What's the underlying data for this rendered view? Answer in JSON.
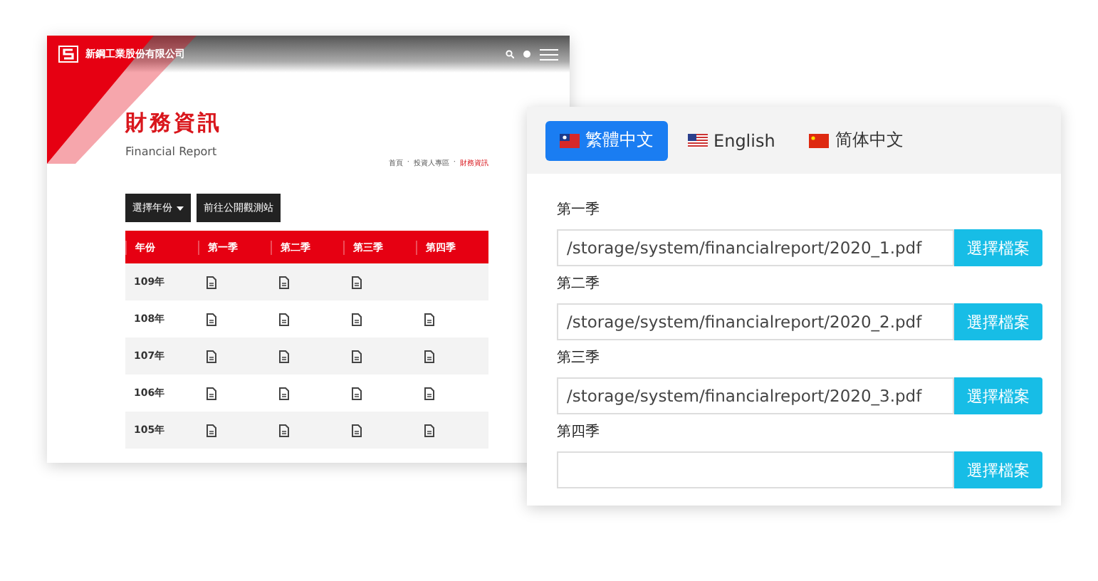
{
  "site": {
    "company": "新鋼工業股份有限公司",
    "title": "財務資訊",
    "subtitle": "Financial Report",
    "breadcrumb_separator": "·",
    "breadcrumb": [
      {
        "label": "首頁",
        "current": false
      },
      {
        "label": "投資人專區",
        "current": false
      },
      {
        "label": "財務資訊",
        "current": true
      }
    ],
    "buttons": [
      {
        "label": "選擇年份",
        "dropdown": true
      },
      {
        "label": "前往公開觀測站",
        "dropdown": false
      }
    ],
    "table": {
      "columns": [
        "年份",
        "第一季",
        "第二季",
        "第三季",
        "第四季"
      ],
      "rows": [
        {
          "year": "109年",
          "files": [
            true,
            true,
            true,
            false
          ]
        },
        {
          "year": "108年",
          "files": [
            true,
            true,
            true,
            true
          ]
        },
        {
          "year": "107年",
          "files": [
            true,
            true,
            true,
            true
          ]
        },
        {
          "year": "106年",
          "files": [
            true,
            true,
            true,
            true
          ]
        },
        {
          "year": "105年",
          "files": [
            true,
            true,
            true,
            true
          ]
        }
      ]
    }
  },
  "editor": {
    "tabs": [
      {
        "label": "繁體中文",
        "kind": "tw",
        "selected": true
      },
      {
        "label": "English",
        "kind": "us",
        "selected": false
      },
      {
        "label": "简体中文",
        "kind": "cn",
        "selected": false
      }
    ],
    "fields": [
      {
        "label": "第一季",
        "value": "/storage/system/financialreport/2020_1.pdf",
        "button": "選擇檔案"
      },
      {
        "label": "第二季",
        "value": "/storage/system/financialreport/2020_2.pdf",
        "button": "選擇檔案"
      },
      {
        "label": "第三季",
        "value": "/storage/system/financialreport/2020_3.pdf",
        "button": "選擇檔案"
      },
      {
        "label": "第四季",
        "button": "選擇檔案"
      }
    ]
  }
}
